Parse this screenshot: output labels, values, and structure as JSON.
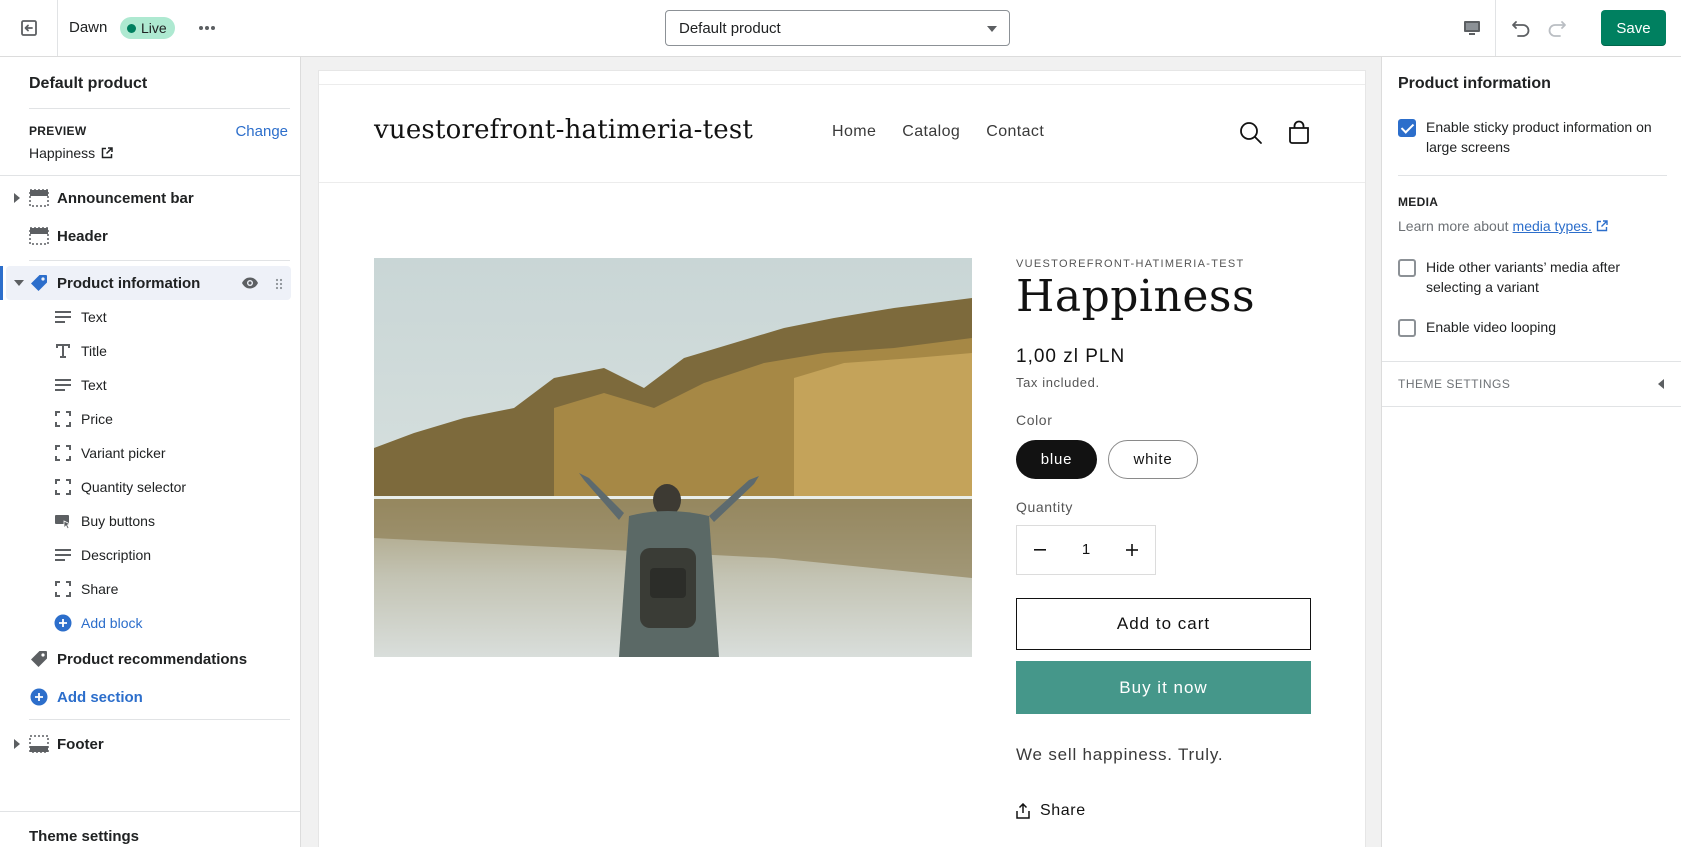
{
  "topbar": {
    "theme_name": "Dawn",
    "live_label": "Live",
    "template": "Default product",
    "save_label": "Save"
  },
  "left": {
    "title": "Default product",
    "preview_label": "PREVIEW",
    "change_label": "Change",
    "preview_value": "Happiness",
    "sections": {
      "announcement": "Announcement bar",
      "header": "Header",
      "product_info": "Product information",
      "recommendations": "Product recommendations",
      "add_section": "Add section",
      "footer": "Footer"
    },
    "blocks": [
      "Text",
      "Title",
      "Text",
      "Price",
      "Variant picker",
      "Quantity selector",
      "Buy buttons",
      "Description",
      "Share"
    ],
    "add_block": "Add block",
    "theme_settings": "Theme settings"
  },
  "store": {
    "name": "vuestorefront-hatimeria-test",
    "nav": [
      "Home",
      "Catalog",
      "Contact"
    ],
    "vendor": "VUESTOREFRONT-HATIMERIA-TEST",
    "title": "Happiness",
    "price": "1,00 zl PLN",
    "tax": "Tax included.",
    "color_label": "Color",
    "colors": [
      "blue",
      "white"
    ],
    "quantity_label": "Quantity",
    "quantity": "1",
    "add_to_cart": "Add to cart",
    "buy_now": "Buy it now",
    "description": "We sell happiness. Truly.",
    "share": "Share"
  },
  "right": {
    "title": "Product information",
    "sticky_label": "Enable sticky product information on large screens",
    "sticky_checked": true,
    "media_heading": "MEDIA",
    "media_help": "Learn more about",
    "media_link": "media types.",
    "hide_variants_label": "Hide other variants’ media after selecting a variant",
    "hide_variants_checked": false,
    "video_loop_label": "Enable video looping",
    "video_loop_checked": false,
    "theme_settings": "THEME SETTINGS"
  },
  "colors": {
    "accent": "#008060",
    "link": "#2c6ecb",
    "buy_now": "#45978a"
  }
}
